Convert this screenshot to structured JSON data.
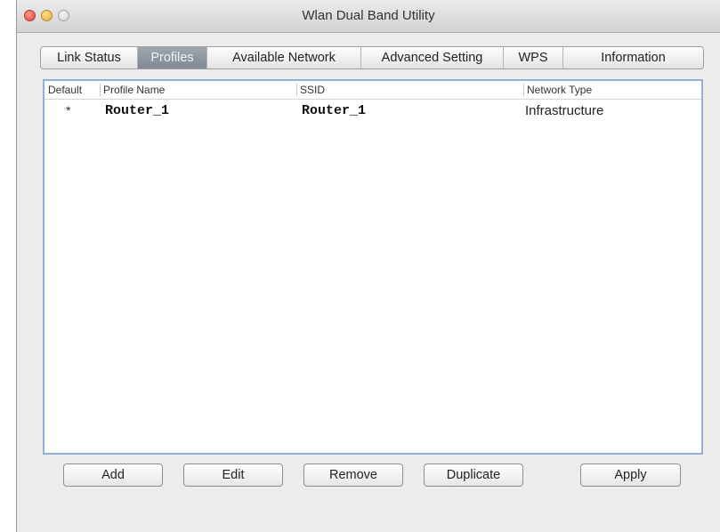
{
  "window": {
    "title": "Wlan Dual Band Utility"
  },
  "tabs": [
    {
      "label": "Link Status",
      "active": false
    },
    {
      "label": "Profiles",
      "active": true
    },
    {
      "label": "Available Network",
      "active": false
    },
    {
      "label": "Advanced Setting",
      "active": false
    },
    {
      "label": "WPS",
      "active": false
    },
    {
      "label": "Information",
      "active": false
    }
  ],
  "profile_table": {
    "columns": [
      "Default",
      "Profile Name",
      "SSID",
      "Network Type"
    ],
    "rows": [
      {
        "default": "*",
        "profile_name": "Router_1",
        "ssid": "Router_1",
        "network_type": "Infrastructure"
      }
    ]
  },
  "buttons": {
    "add": "Add",
    "edit": "Edit",
    "remove": "Remove",
    "duplicate": "Duplicate",
    "apply": "Apply"
  },
  "colors": {
    "active_tab": "#8a929c",
    "list_focus_border": "#8fb0d8",
    "close_button": "#e0443a",
    "minimize_button": "#e8a93a"
  }
}
